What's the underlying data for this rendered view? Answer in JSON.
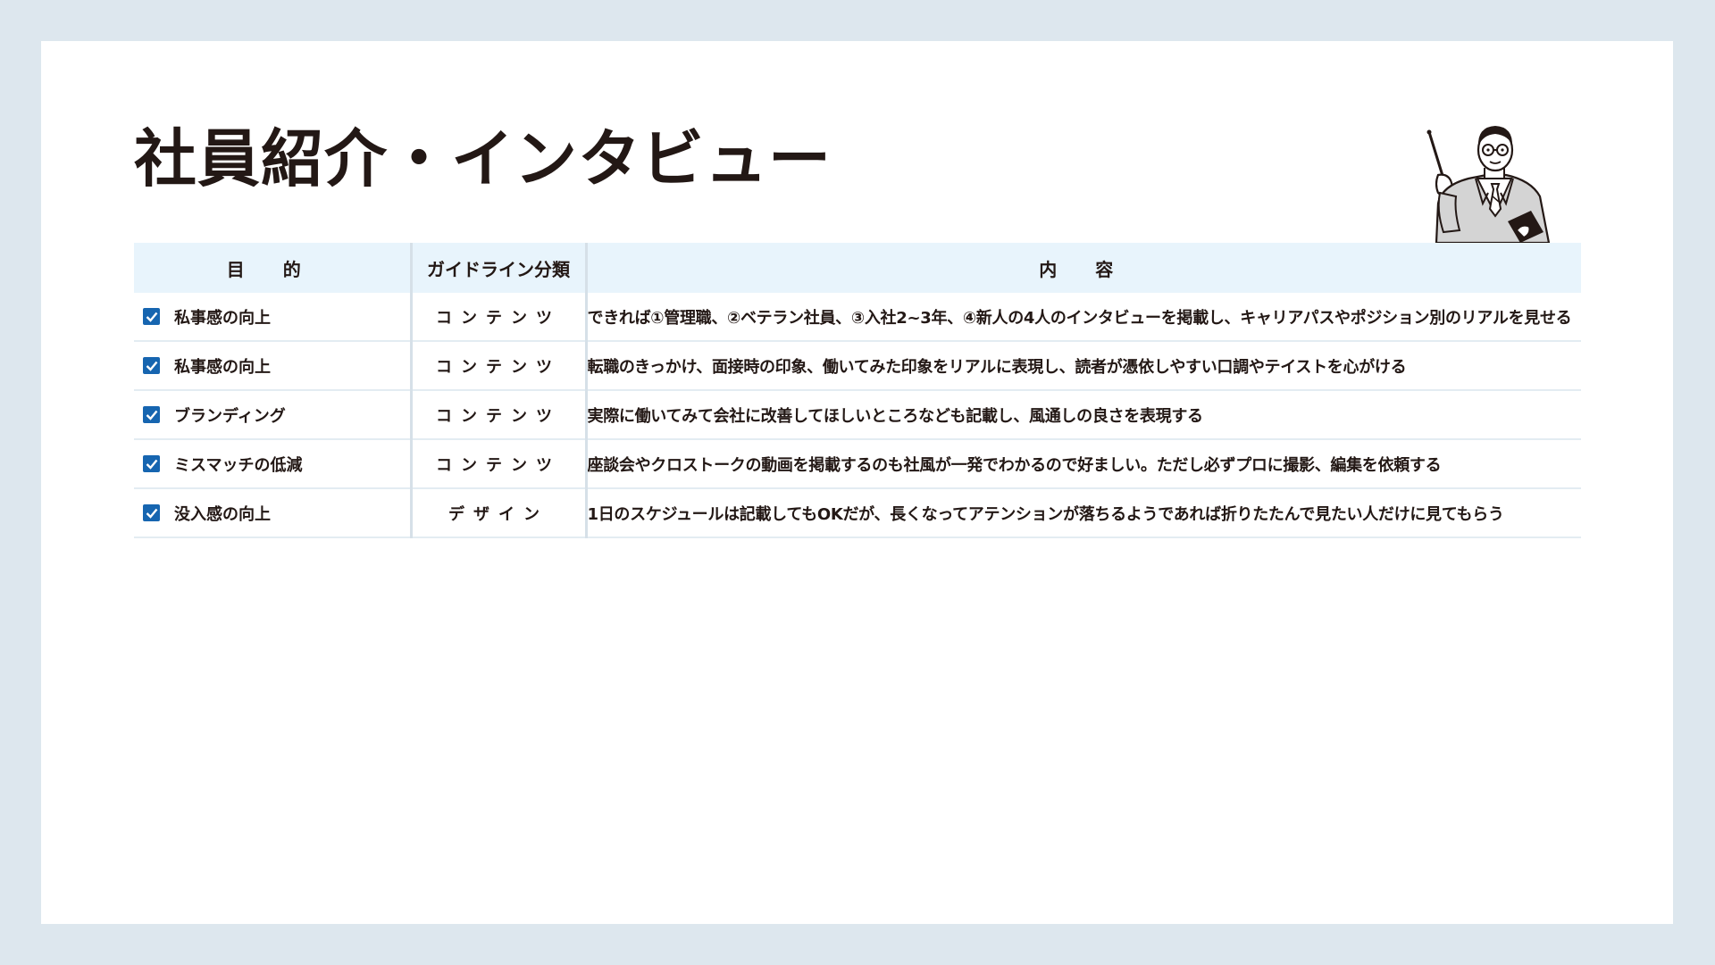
{
  "title": "社員紹介・インタビュー",
  "table": {
    "headers": {
      "purpose": "目 的",
      "guideline": "ガイドライン分類",
      "content": "内 容"
    },
    "rows": [
      {
        "checked": true,
        "purpose": "私事感の向上",
        "guideline": "コンテンツ",
        "content": "できれば①管理職、②ベテラン社員、③入社2~3年、④新人の4人のインタビューを掲載し、キャリアパスやポジション別のリアルを見せる"
      },
      {
        "checked": true,
        "purpose": "私事感の向上",
        "guideline": "コンテンツ",
        "content": "転職のきっかけ、面接時の印象、働いてみた印象をリアルに表現し、読者が憑依しやすい口調やテイストを心がける"
      },
      {
        "checked": true,
        "purpose": "ブランディング",
        "guideline": "コンテンツ",
        "content": "実際に働いてみて会社に改善してほしいところなども記載し、風通しの良さを表現する"
      },
      {
        "checked": true,
        "purpose": "ミスマッチの低減",
        "guideline": "コンテンツ",
        "content": "座談会やクロストークの動画を掲載するのも社風が一発でわかるので好ましい。ただし必ずプロに撮影、編集を依頼する"
      },
      {
        "checked": true,
        "purpose": "没入感の向上",
        "guideline": "デザイン",
        "content": "1日のスケジュールは記載してもOKだが、長くなってアテンションが落ちるようであれば折りたたんで見たい人だけに見てもらう"
      }
    ]
  },
  "colors": {
    "background": "#dde7ee",
    "header_fill": "#e8f4fc",
    "checkbox": "#1665b0",
    "text": "#231815"
  },
  "icons": {
    "checkbox": "checkbox-checked-icon",
    "illustration": "teacher-with-pointer-illustration"
  }
}
